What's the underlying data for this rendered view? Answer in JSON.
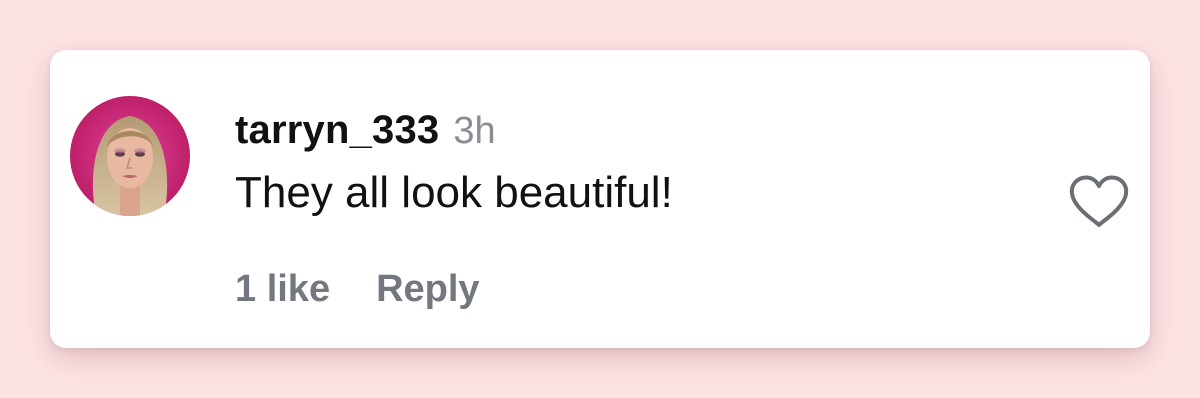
{
  "comment": {
    "username": "tarryn_333",
    "timestamp": "3h",
    "text": "They all look beautiful!",
    "likes_label": "1 like",
    "reply_label": "Reply",
    "avatar_icon": "profile-photo",
    "like_icon": "heart-outline-icon"
  },
  "colors": {
    "page_background": "#fde2e4",
    "card_background": "#ffffff",
    "username": "#111111",
    "secondary_text": "#8a8d93",
    "action_text": "#737780",
    "avatar_ring": "#c81e6a"
  }
}
